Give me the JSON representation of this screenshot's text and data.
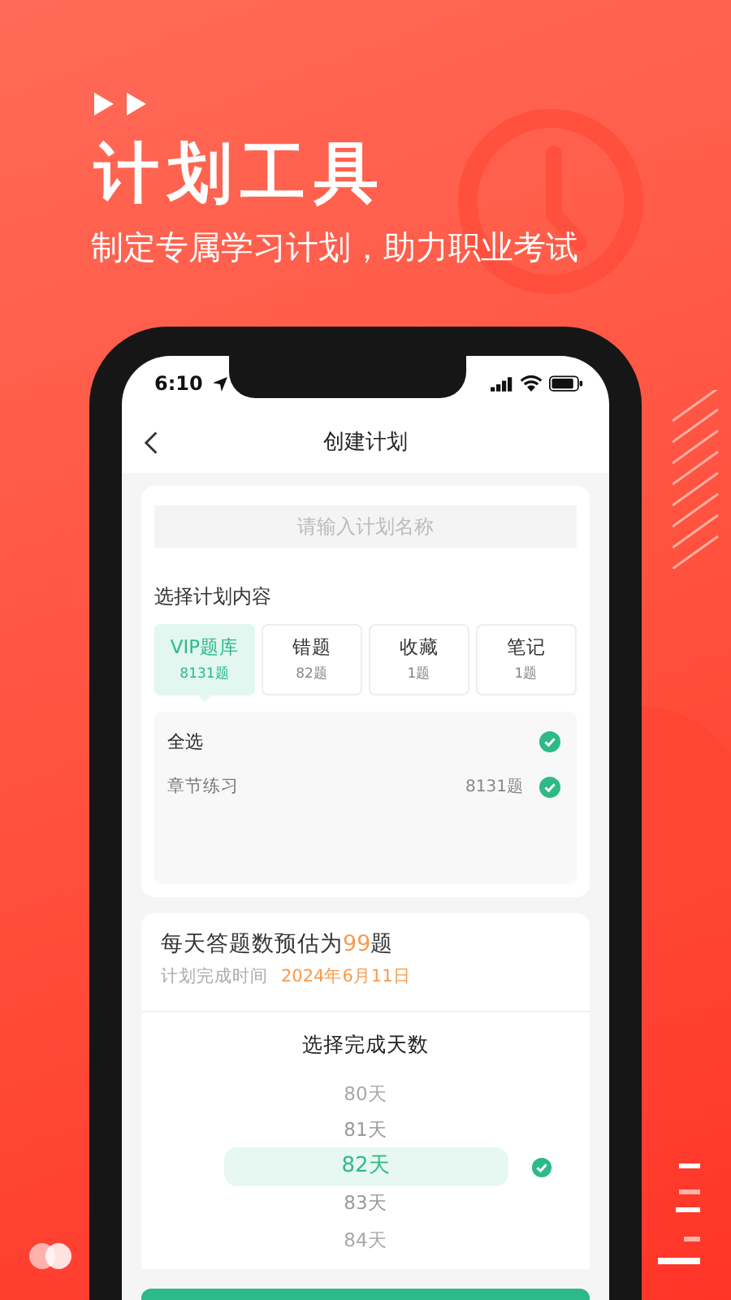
{
  "header": {
    "title": "计划工具",
    "subtitle": "制定专属学习计划，助力职业考试"
  },
  "status_bar": {
    "time": "6:10"
  },
  "nav": {
    "title": "创建计划"
  },
  "plan_name": {
    "placeholder": "请输入计划名称"
  },
  "content_section": {
    "label": "选择计划内容",
    "tabs": [
      {
        "label": "VIP题库",
        "count": "8131题",
        "selected": true
      },
      {
        "label": "错题",
        "count": "82题",
        "selected": false
      },
      {
        "label": "收藏",
        "count": "1题",
        "selected": false
      },
      {
        "label": "笔记",
        "count": "1题",
        "selected": false
      }
    ]
  },
  "select_all": {
    "label": "全选",
    "checked": true
  },
  "items": [
    {
      "label": "章节练习",
      "count": "8131题",
      "checked": true
    }
  ],
  "estimate": {
    "prefix": "每天答题数预估为",
    "count": "99",
    "suffix": "题",
    "date_label": "计划完成时间",
    "date": "2024年6月11日"
  },
  "days_picker": {
    "title": "选择完成天数",
    "options": [
      {
        "label": "80天",
        "selected": false
      },
      {
        "label": "81天",
        "selected": false
      },
      {
        "label": "82天",
        "selected": true
      },
      {
        "label": "83天",
        "selected": false
      },
      {
        "label": "84天",
        "selected": false
      }
    ]
  }
}
